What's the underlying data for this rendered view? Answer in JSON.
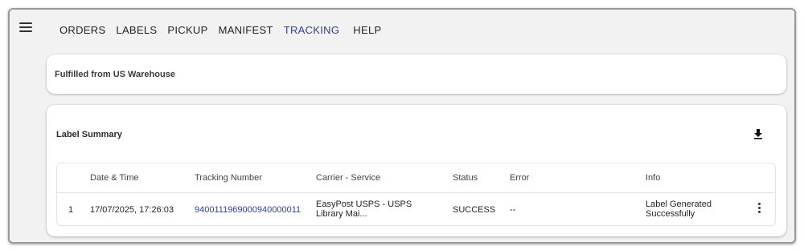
{
  "nav": {
    "items": [
      {
        "label": "ORDERS"
      },
      {
        "label": "LABELS"
      },
      {
        "label": "PICKUP"
      },
      {
        "label": "MANIFEST"
      },
      {
        "label": "TRACKING",
        "active": true
      },
      {
        "label": "HELP"
      }
    ],
    "active_color": "#2f3f9e"
  },
  "warehouse": {
    "label": "Fulfilled from US Warehouse"
  },
  "summary": {
    "title": "Label Summary",
    "download_icon": "download-icon",
    "columns": [
      "Date & Time",
      "Tracking Number",
      "Carrier - Service",
      "Status",
      "Error",
      "Info"
    ],
    "rows": [
      {
        "index": "1",
        "datetime": "17/07/2025, 17:26:03",
        "tracking_number": "9400111969000940000011",
        "carrier_service_line1": "EasyPost USPS - USPS",
        "carrier_service_line2": "Library Mai...",
        "status": "SUCCESS",
        "error": "--",
        "info_line1": "Label Generated",
        "info_line2": "Successfully",
        "actions_icon": "more-vertical-icon"
      }
    ]
  }
}
